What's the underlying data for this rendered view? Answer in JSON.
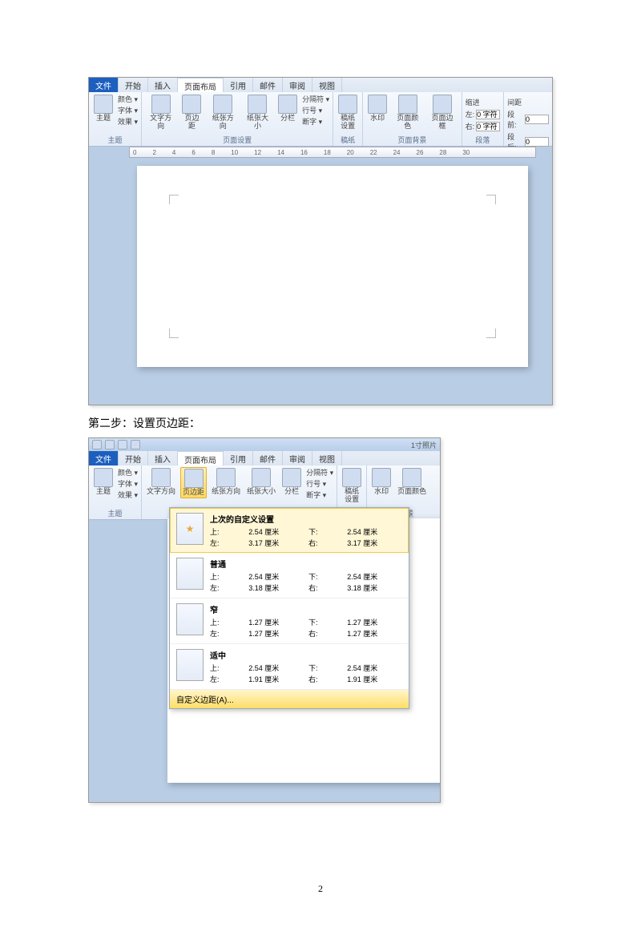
{
  "tabs": {
    "file": "文件",
    "home": "开始",
    "insert": "插入",
    "layout": "页面布局",
    "reference": "引用",
    "mail": "邮件",
    "review": "审阅",
    "view": "视图"
  },
  "ribbon": {
    "theme": {
      "name": "主题",
      "colors": "颜色 ▾",
      "fonts": "字体 ▾",
      "effects": "效果 ▾",
      "btn": "主题"
    },
    "pageSetup": {
      "name": "页面设置",
      "textdir": "文字方向",
      "margins": "页边距",
      "orientation": "纸张方向",
      "size": "纸张大小",
      "columns": "分栏",
      "breaks": "分隔符 ▾",
      "lineNum": "行号 ▾",
      "hyphen": "断字 ▾"
    },
    "paper": {
      "name": "稿纸",
      "btn": "稿纸\n设置"
    },
    "bg": {
      "name": "页面背景",
      "watermark": "水印",
      "pagecolor": "页面颜色",
      "border": "页面边框"
    },
    "indent": {
      "name": "缩进",
      "left": "左:",
      "right": "右:",
      "val": "0 字符"
    },
    "spacing": {
      "name": "间距",
      "before": "段前:",
      "after": "段后:",
      "val": "0"
    },
    "paragraph_group": "段落"
  },
  "ruler": [
    "0",
    "2",
    "4",
    "6",
    "8",
    "10",
    "12",
    "14",
    "16",
    "18",
    "20",
    "22",
    "24",
    "26",
    "28",
    "30"
  ],
  "step_text": "第二步：设置页边距：",
  "title2": "1寸照片",
  "dropdown": {
    "last": {
      "title": "上次的自定义设置",
      "top_l": "上:",
      "top_v": "2.54 厘米",
      "bottom_l": "下:",
      "bottom_v": "2.54 厘米",
      "left_l": "左:",
      "left_v": "3.17 厘米",
      "right_l": "右:",
      "right_v": "3.17 厘米"
    },
    "normal": {
      "title": "普通",
      "top_l": "上:",
      "top_v": "2.54 厘米",
      "bottom_l": "下:",
      "bottom_v": "2.54 厘米",
      "left_l": "左:",
      "left_v": "3.18 厘米",
      "right_l": "右:",
      "right_v": "3.18 厘米"
    },
    "narrow": {
      "title": "窄",
      "top_l": "上:",
      "top_v": "1.27 厘米",
      "bottom_l": "下:",
      "bottom_v": "1.27 厘米",
      "left_l": "左:",
      "left_v": "1.27 厘米",
      "right_l": "右:",
      "right_v": "1.27 厘米"
    },
    "moderate": {
      "title": "适中",
      "top_l": "上:",
      "top_v": "2.54 厘米",
      "bottom_l": "下:",
      "bottom_v": "2.54 厘米",
      "left_l": "左:",
      "left_v": "1.91 厘米",
      "right_l": "右:",
      "right_v": "1.91 厘米"
    },
    "custom": "自定义边距(A)..."
  },
  "page_number": "2"
}
